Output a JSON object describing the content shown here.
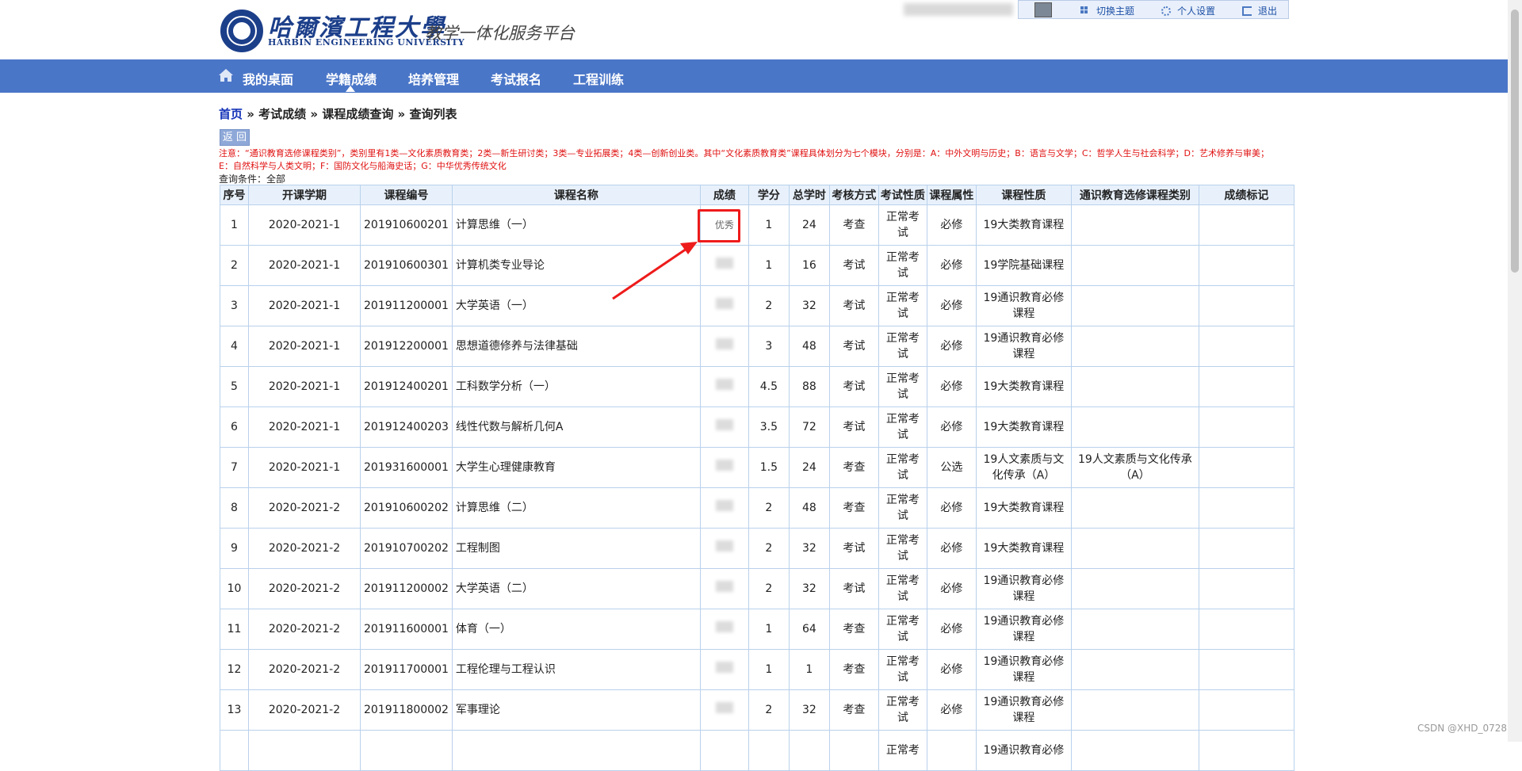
{
  "header": {
    "logo_cn": "哈爾濱工程大學",
    "logo_en": "HARBIN ENGINEERING UNIVERSITY",
    "platform_title": "教学一体化服务平台",
    "top_links": {
      "switch_theme": "切换主题",
      "personal_settings": "个人设置",
      "logout": "退出"
    }
  },
  "nav": {
    "items": [
      "我的桌面",
      "学籍成绩",
      "培养管理",
      "考试报名",
      "工程训练"
    ],
    "active": "学籍成绩"
  },
  "breadcrumb": {
    "home": "首页",
    "sep": " » ",
    "path": [
      "考试成绩",
      "课程成绩查询",
      "查询列表"
    ]
  },
  "back_label": "返 回",
  "notice": "注意：“通识教育选修课程类别”，类别里有1类—文化素质教育类；2类—新生研讨类；3类—专业拓展类；4类—创新创业类。其中“文化素质教育类”课程具体划分为七个模块，分别是：A：中外文明与历史；B：语言与文学；C：哲学人生与社会科学；D：艺术修养与审美；E：自然科学与人类文明；F：国防文化与船海史话；G：中华优秀传统文化",
  "query_condition": "查询条件：全部",
  "table": {
    "headers": [
      "序号",
      "开课学期",
      "课程编号",
      "课程名称",
      "成绩",
      "学分",
      "总学时",
      "考核方式",
      "考试性质",
      "课程属性",
      "课程性质",
      "通识教育选修课程类别",
      "成绩标记"
    ],
    "rows": [
      [
        "1",
        "2020-2021-1",
        "201910600201",
        "计算思维（一）",
        "优秀",
        "1",
        "24",
        "考查",
        "正常考试",
        "必修",
        "19大类教育课程",
        "",
        ""
      ],
      [
        "2",
        "2020-2021-1",
        "201910600301",
        "计算机类专业导论",
        "",
        "1",
        "16",
        "考试",
        "正常考试",
        "必修",
        "19学院基础课程",
        "",
        ""
      ],
      [
        "3",
        "2020-2021-1",
        "201911200001",
        "大学英语（一）",
        "",
        "2",
        "32",
        "考试",
        "正常考试",
        "必修",
        "19通识教育必修课程",
        "",
        ""
      ],
      [
        "4",
        "2020-2021-1",
        "201912200001",
        "思想道德修养与法律基础",
        "",
        "3",
        "48",
        "考试",
        "正常考试",
        "必修",
        "19通识教育必修课程",
        "",
        ""
      ],
      [
        "5",
        "2020-2021-1",
        "201912400201",
        "工科数学分析（一）",
        "",
        "4.5",
        "88",
        "考试",
        "正常考试",
        "必修",
        "19大类教育课程",
        "",
        ""
      ],
      [
        "6",
        "2020-2021-1",
        "201912400203",
        "线性代数与解析几何A",
        "",
        "3.5",
        "72",
        "考试",
        "正常考试",
        "必修",
        "19大类教育课程",
        "",
        ""
      ],
      [
        "7",
        "2020-2021-1",
        "201931600001",
        "大学生心理健康教育",
        "",
        "1.5",
        "24",
        "考查",
        "正常考试",
        "公选",
        "19人文素质与文化传承（A）",
        "19人文素质与文化传承（A）",
        ""
      ],
      [
        "8",
        "2020-2021-2",
        "201910600202",
        "计算思维（二）",
        "",
        "2",
        "48",
        "考查",
        "正常考试",
        "必修",
        "19大类教育课程",
        "",
        ""
      ],
      [
        "9",
        "2020-2021-2",
        "201910700202",
        "工程制图",
        "",
        "2",
        "32",
        "考试",
        "正常考试",
        "必修",
        "19大类教育课程",
        "",
        ""
      ],
      [
        "10",
        "2020-2021-2",
        "201911200002",
        "大学英语（二）",
        "",
        "2",
        "32",
        "考试",
        "正常考试",
        "必修",
        "19通识教育必修课程",
        "",
        ""
      ],
      [
        "11",
        "2020-2021-2",
        "201911600001",
        "体育（一）",
        "",
        "1",
        "64",
        "考查",
        "正常考试",
        "必修",
        "19通识教育必修课程",
        "",
        ""
      ],
      [
        "12",
        "2020-2021-2",
        "201911700001",
        "工程伦理与工程认识",
        "",
        "1",
        "1",
        "考查",
        "正常考试",
        "必修",
        "19通识教育必修课程",
        "",
        ""
      ],
      [
        "13",
        "2020-2021-2",
        "201911800002",
        "军事理论",
        "",
        "2",
        "32",
        "考查",
        "正常考试",
        "必修",
        "19通识教育必修课程",
        "",
        ""
      ],
      [
        "",
        "",
        "",
        "",
        "",
        "",
        "",
        "",
        "正常考",
        "",
        "19通识教育必修",
        "",
        ""
      ]
    ]
  },
  "watermark": "CSDN @XHD_0728",
  "colors": {
    "nav_bg": "#4a76c8",
    "header_bg": "#e8f1fb",
    "border": "#b9d1ec",
    "notice": "#e01010",
    "annotation": "#ee1b1b"
  }
}
